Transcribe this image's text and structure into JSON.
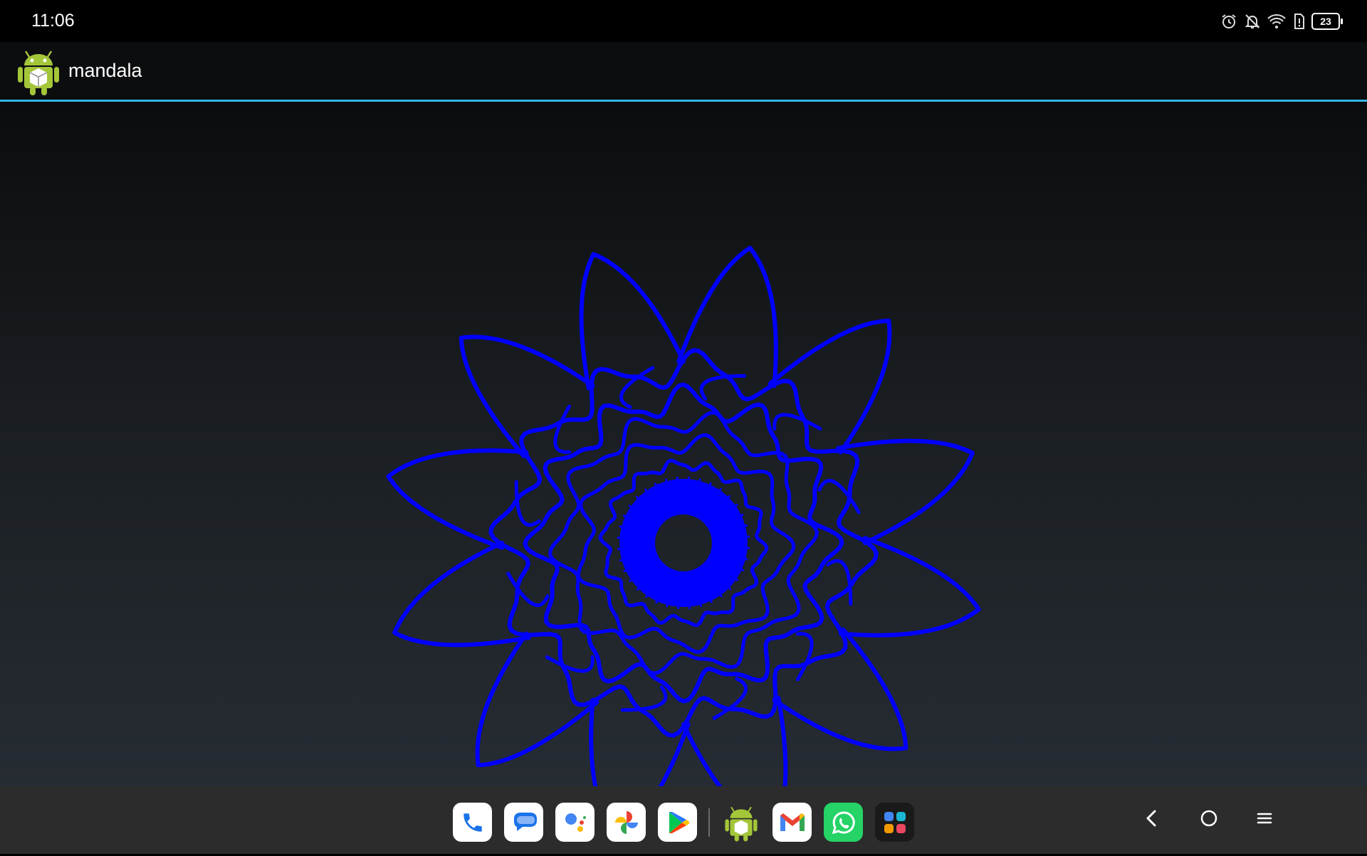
{
  "status_bar": {
    "time": "11:06",
    "icons": [
      "alarm-icon",
      "notifications-off-icon",
      "wifi-icon",
      "sim-alert-icon",
      "battery-icon"
    ],
    "battery_level": "23"
  },
  "action_bar": {
    "app_icon": "android-app-icon",
    "title": "mandala",
    "accent_color": "#33b5e5"
  },
  "canvas": {
    "stroke_color": "#0000ff"
  },
  "taskbar": {
    "apps": [
      {
        "name": "Phone",
        "icon": "phone-icon"
      },
      {
        "name": "Messages",
        "icon": "messages-icon"
      },
      {
        "name": "Assistant",
        "icon": "assistant-icon"
      },
      {
        "name": "Photos",
        "icon": "photos-icon"
      },
      {
        "name": "Play Store",
        "icon": "play-store-icon"
      },
      {
        "name": "mandala",
        "icon": "android-app-icon"
      },
      {
        "name": "Gmail",
        "icon": "gmail-icon"
      },
      {
        "name": "WhatsApp",
        "icon": "whatsapp-icon"
      },
      {
        "name": "All apps",
        "icon": "app-drawer-icon"
      }
    ],
    "nav": [
      "back-icon",
      "home-icon",
      "menu-icon"
    ]
  }
}
